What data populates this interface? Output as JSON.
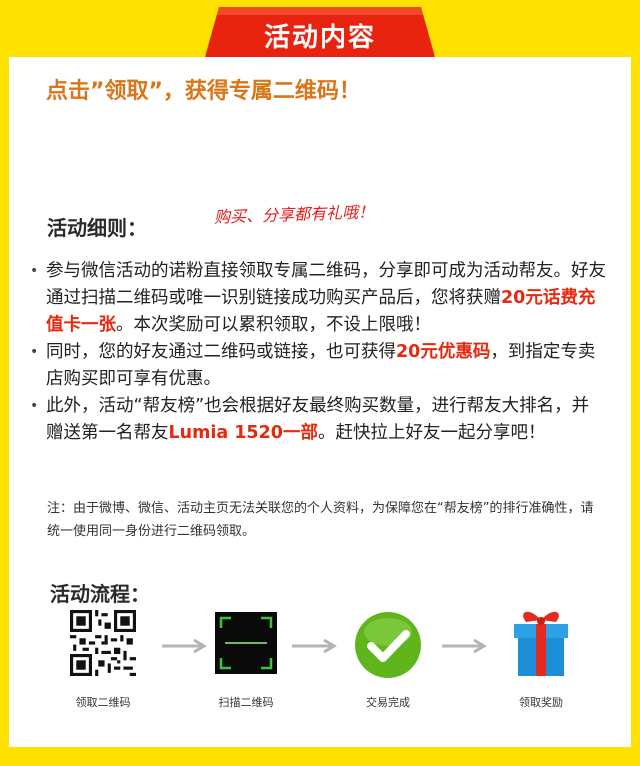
{
  "title": "活动内容",
  "headline": "点击”领取”，获得专属二维码！",
  "slogan": "购买、分享都有礼哦！",
  "rules_heading": "活动细则：",
  "rules": [
    {
      "segments": [
        {
          "t": "参与微信活动的诺粉直接领取专属二维码，分享即可成为活动帮友。好友通过扫描二维码或唯一识别链接成功购买产品后，您将获赠",
          "h": false
        },
        {
          "t": "20元话费充值卡一张",
          "h": true
        },
        {
          "t": "。本次奖励可以累积领取，不设上限哦！",
          "h": false
        }
      ]
    },
    {
      "segments": [
        {
          "t": "同时，您的好友通过二维码或链接，也可获得",
          "h": false
        },
        {
          "t": "20元优惠码",
          "h": true
        },
        {
          "t": "，到指定专卖店购买即可享有优惠。",
          "h": false
        }
      ]
    },
    {
      "segments": [
        {
          "t": "此外，活动“帮友榜”也会根据好友最终购买数量，进行帮友大排名，并赠送第一名帮友",
          "h": false
        },
        {
          "t": "Lumia 1520一部",
          "h": true
        },
        {
          "t": "。赶快拉上好友一起分享吧！",
          "h": false
        }
      ]
    }
  ],
  "note": "注：由于微博、微信、活动主页无法关联您的个人资料，为保障您在“帮友榜”的排行准确性，请统一使用同一身份进行二维码领取。",
  "flow_heading": "活动流程：",
  "flow_steps": [
    {
      "label": "领取二维码",
      "icon": "qr-code-icon"
    },
    {
      "label": "扫描二维码",
      "icon": "scanner-icon"
    },
    {
      "label": "交易完成",
      "icon": "checkmark-icon"
    },
    {
      "label": "领取奖励",
      "icon": "gift-box-icon"
    }
  ],
  "colors": {
    "frame": "#ffe100",
    "title_tab": "#e8230f",
    "headline": "#d9761a",
    "highlight": "#e8280f",
    "check": "#5fb51b",
    "gift": "#1d8fd6"
  }
}
